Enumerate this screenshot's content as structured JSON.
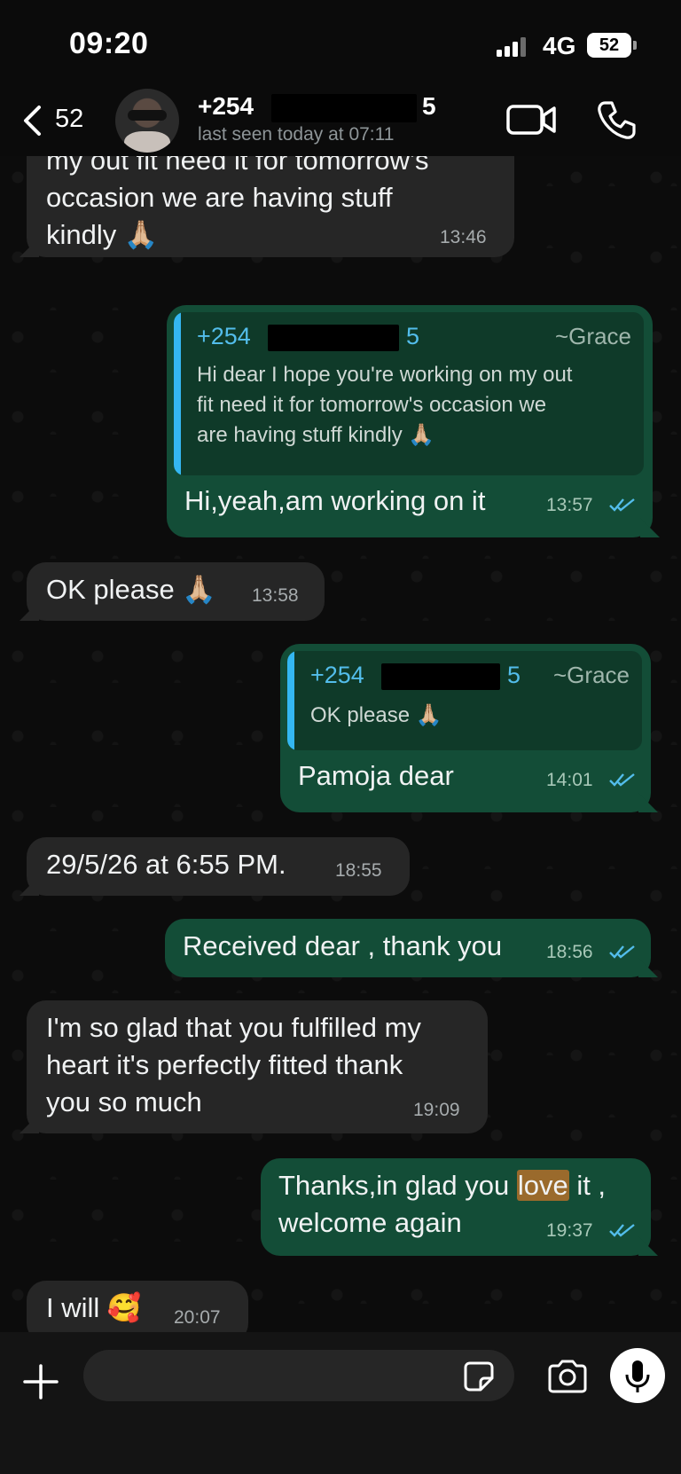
{
  "status": {
    "time": "09:20",
    "network": "4G",
    "battery": "52"
  },
  "header": {
    "back_count": "52",
    "contact_prefix": "+254",
    "contact_suffix": "5",
    "last_seen": "last seen today at 07:11"
  },
  "messages": [
    {
      "dir": "in",
      "text_lines": [
        "my out fit  need it for tomorrow's",
        "occasion  we are having stuff",
        "kindly 🙏🏼"
      ],
      "time": "13:46"
    },
    {
      "dir": "out",
      "quote": {
        "name_prefix": "+254",
        "name_suffix": "5",
        "author": "~Grace",
        "lines": [
          "Hi dear  I hope  you're working on my out",
          "fit  need it for tomorrow's  occasion  we",
          "are having stuff  kindly 🙏🏼"
        ]
      },
      "text": "Hi,yeah,am working on it",
      "time": "13:57"
    },
    {
      "dir": "in",
      "text": "OK please 🙏🏼",
      "time": "13:58"
    },
    {
      "dir": "out",
      "quote": {
        "name_prefix": "+254",
        "name_suffix": "5",
        "author": "~Grace",
        "lines": [
          "OK please 🙏🏼"
        ]
      },
      "text": "Pamoja dear",
      "time": "14:01"
    },
    {
      "dir": "in",
      "text": "29/5/26 at 6:55 PM.",
      "time": "18:55"
    },
    {
      "dir": "out",
      "text": "Received dear , thank you",
      "time": "18:56"
    },
    {
      "dir": "in",
      "text_lines": [
        "I'm so glad that you fulfilled my",
        "heart  it's perfectly fitted  thank",
        "you so much"
      ],
      "time": "19:09"
    },
    {
      "dir": "out",
      "text_parts": [
        "Thanks,in glad you ",
        "love",
        " it ,"
      ],
      "text_line2": "welcome again",
      "time": "19:37"
    },
    {
      "dir": "in",
      "text": "I will 🥰",
      "time": "20:07"
    }
  ],
  "composer": {
    "placeholder": ""
  },
  "colors": {
    "incoming": "#262626",
    "outgoing": "#134d37",
    "accent": "#53bdeb"
  },
  "icons": [
    "back-chevron-icon",
    "video-call-icon",
    "phone-icon",
    "plus-icon",
    "sticker-icon",
    "camera-icon",
    "microphone-icon",
    "read-ticks-icon"
  ]
}
